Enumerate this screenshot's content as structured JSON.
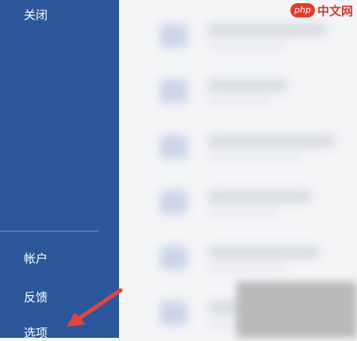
{
  "sidebar": {
    "items": [
      {
        "label": "关闭"
      },
      {
        "label": "帐户"
      },
      {
        "label": "反馈"
      },
      {
        "label": "选项"
      }
    ]
  },
  "watermark": {
    "badge": "php",
    "text": "中文网"
  },
  "colors": {
    "sidebar_bg": "#2b579a",
    "content_bg": "#f4f5f7",
    "arrow": "#e0463c",
    "watermark_red": "#e63a2c"
  }
}
